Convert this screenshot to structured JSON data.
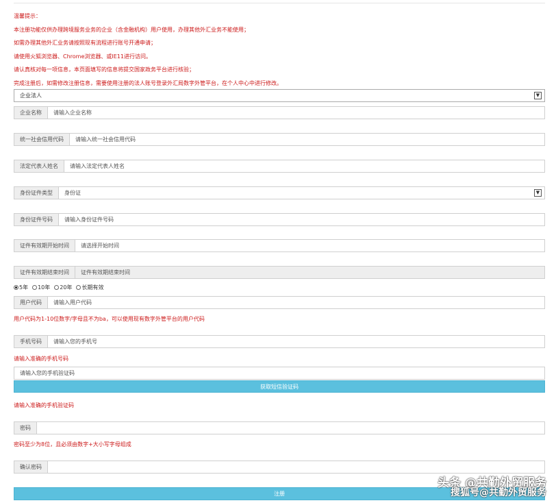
{
  "notice": {
    "head": "温馨提示：",
    "lines": [
      "本注册功能仅供办理跨境服务业务的企业（含金融机构）用户使用，办理其他外汇业务不能使用；",
      "如需办理其他外汇业务请按照现有流程进行账号开通申请；",
      "请使用火狐浏览器、Chrome浏览器、或IE11进行访问。",
      "请认真核对每一项信息，本页面填写的信息将提交国家政务平台进行核验；",
      "完成注册后，如需修改注册信息，需要使用注册的法人账号登录外汇局数字外管平台，在个人中心中进行修改。"
    ]
  },
  "form": {
    "user_type": "企业法人",
    "company_name": {
      "label": "企业名称",
      "placeholder": "请输入企业名称"
    },
    "credit_code": {
      "label": "统一社会信用代码",
      "placeholder": "请输入统一社会信用代码"
    },
    "legal_rep": {
      "label": "法定代表人姓名",
      "placeholder": "请输入法定代表人姓名"
    },
    "id_type": {
      "label": "身份证件类型",
      "value": "身份证"
    },
    "id_number": {
      "label": "身份证件号码",
      "placeholder": "请输入身份证件号码"
    },
    "valid_start": {
      "label": "证件有效期开始时间",
      "placeholder": "请选择开始时间"
    },
    "valid_end": {
      "label": "证件有效期结束时间",
      "placeholder": "证件有效期结束时间"
    },
    "validity_options": [
      "5年",
      "10年",
      "20年",
      "长期有效"
    ],
    "user_code": {
      "label": "用户代码",
      "placeholder": "请输入用户代码"
    },
    "user_code_hint": "用户代码为1-10位数字/字母且不为ba，可以使用现有数字外管平台的用户代码",
    "phone": {
      "label": "手机号码",
      "placeholder": "请输入您的手机号"
    },
    "phone_hint": "请输入准确的手机号码",
    "sms_code_placeholder": "请输入您的手机验证码",
    "get_code_button": "获取短信验证码",
    "sms_hint": "请输入准确的手机验证码",
    "password": {
      "label": "密码",
      "placeholder": ""
    },
    "password_hint": "密码至少为8位，且必须由数字+大小写字母组成",
    "confirm_password": {
      "label": "确认密码",
      "placeholder": ""
    },
    "register_button": "注册"
  },
  "watermark": {
    "line1": "头条 @共勤外贸服务",
    "line2": "搜狐号@共勤外贸服务"
  }
}
